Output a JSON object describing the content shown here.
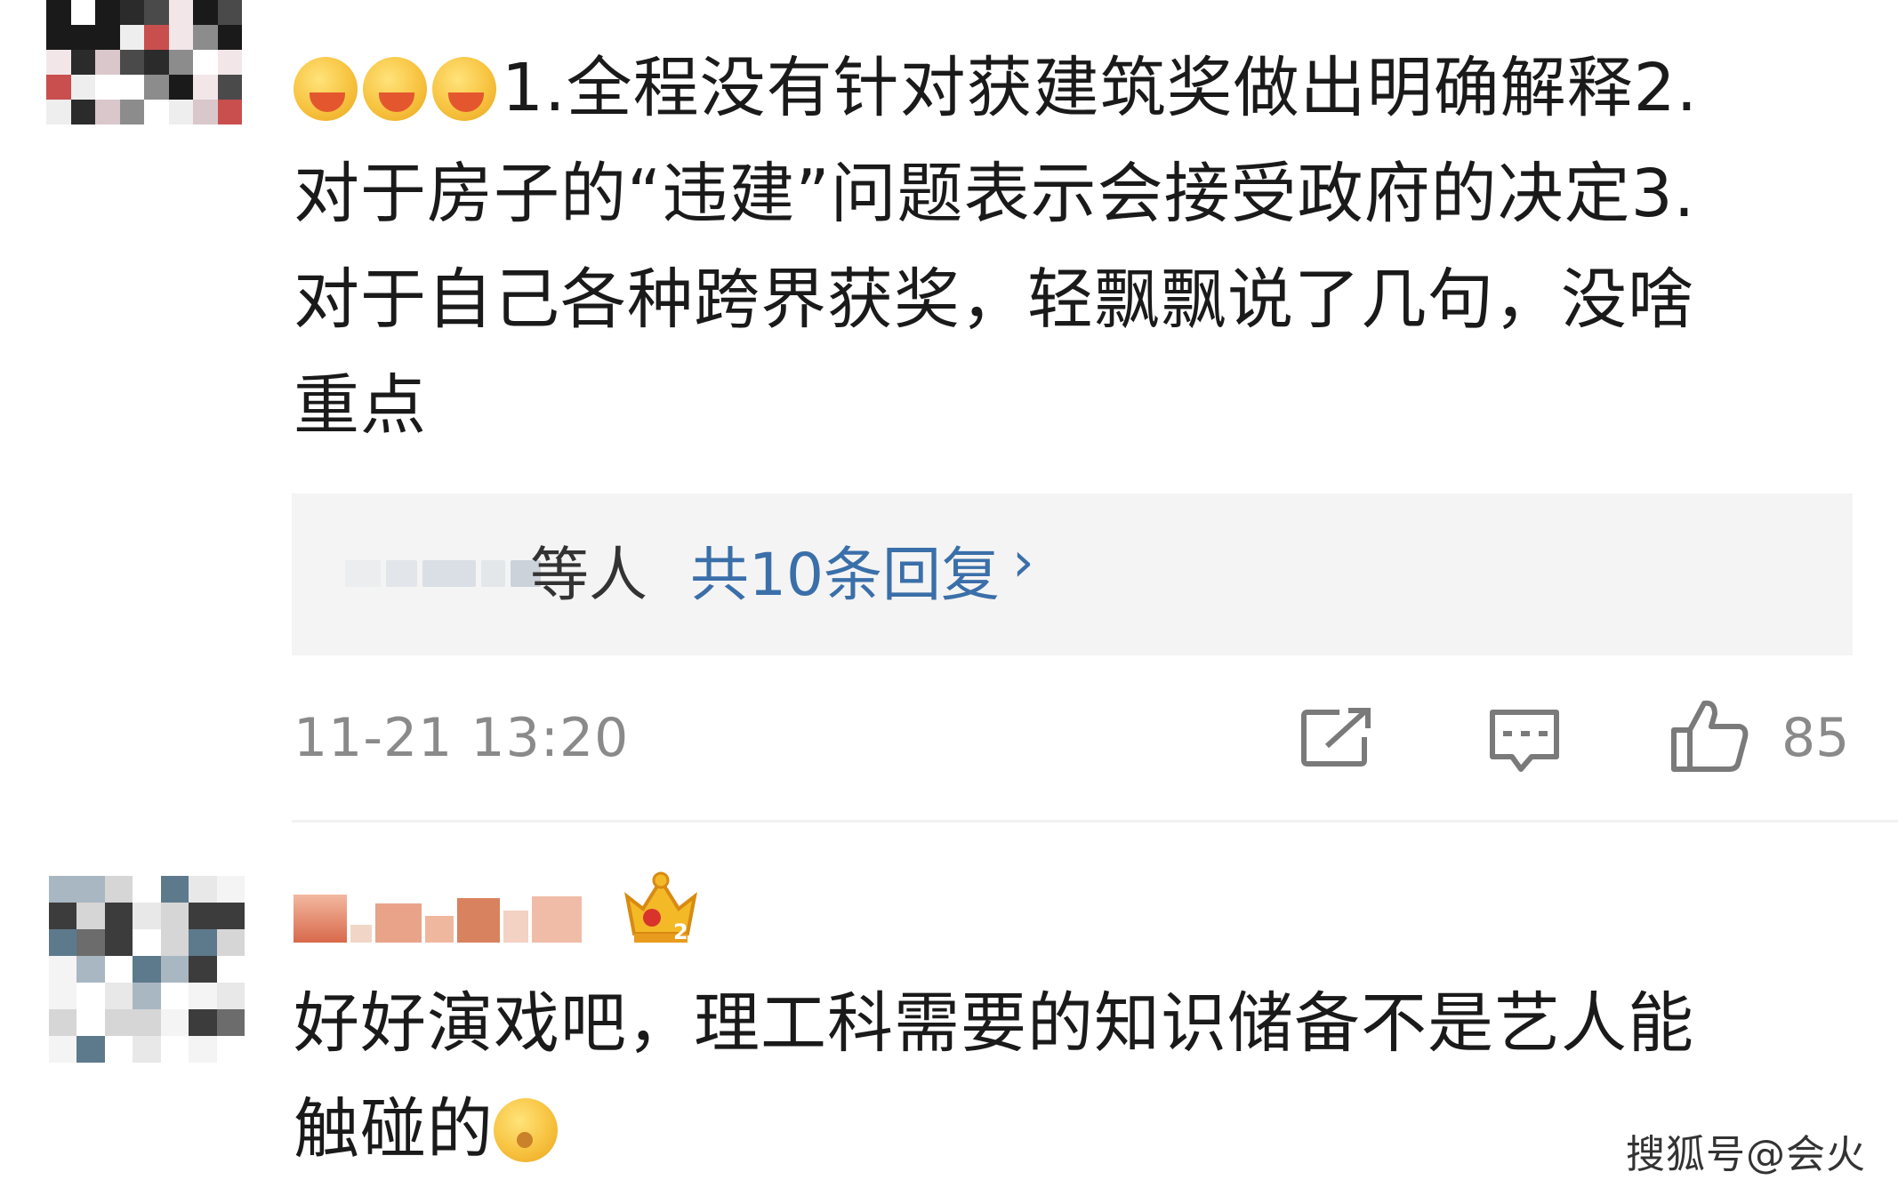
{
  "comments": [
    {
      "text": "1.全程没有针对获建筑奖做出明确解释2.",
      "lines": [
        "对于房子的“违建”问题表示会接受政府的决定3.",
        "对于自己各种跨界获奖，轻飘飘说了几句，没啥",
        "重点"
      ],
      "emoji_prefix": [
        "yum-face-emoji",
        "yum-face-emoji",
        "yum-face-emoji"
      ],
      "replies": {
        "who_suffix": "等人",
        "count_label": "共10条回复",
        "chevron": "›"
      },
      "time": "11-21 13:20",
      "likes": "85",
      "actions": [
        "share-icon",
        "comment-icon",
        "like-icon"
      ]
    },
    {
      "lines": [
        "好好演戏吧，理工科需要的知识储备不是艺人能",
        "触碰的"
      ],
      "emoji_suffix": "thinking-face-emoji",
      "badge": {
        "icon": "crown-badge-icon",
        "level": "2"
      }
    }
  ],
  "watermark": "搜狐号@会火",
  "colors": {
    "link": "#3a6fa9",
    "meta": "#8a8a8a",
    "reply_bg": "#f4f4f4"
  }
}
